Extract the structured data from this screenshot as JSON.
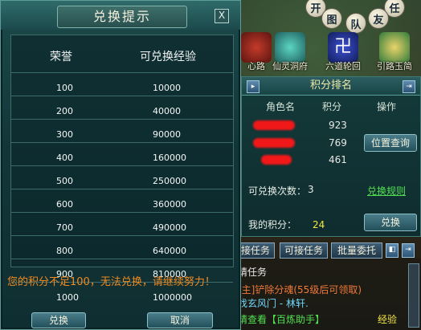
{
  "dialog": {
    "title": "兑换提示",
    "close_label": "X",
    "columns": [
      "荣誉",
      "可兑换经验"
    ],
    "rows": [
      [
        "100",
        "10000"
      ],
      [
        "200",
        "40000"
      ],
      [
        "300",
        "90000"
      ],
      [
        "400",
        "160000"
      ],
      [
        "500",
        "250000"
      ],
      [
        "600",
        "360000"
      ],
      [
        "700",
        "490000"
      ],
      [
        "800",
        "640000"
      ],
      [
        "900",
        "810000"
      ],
      [
        "1000",
        "1000000"
      ]
    ],
    "warning": "您的积分不足100，无法兑换，请继续努力！",
    "confirm_label": "兑换",
    "cancel_label": "取消"
  },
  "top_menu": {
    "round_buttons": [
      "开",
      "任",
      "图",
      "队",
      "友"
    ],
    "features": [
      "心路",
      "仙灵洞府",
      "六道轮回",
      "引路玉简"
    ]
  },
  "ranking": {
    "title": "积分排名",
    "headers": [
      "角色名",
      "积分",
      "操作"
    ],
    "scores": [
      "923",
      "769",
      "461"
    ],
    "query_label": "位置查询",
    "remaining_label": "可兑换次数：",
    "remaining_value": "3",
    "rules_link": "兑换规则",
    "my_score_label": "我的积分：",
    "my_score_value": "24",
    "exchange_label": "兑换"
  },
  "tasks": {
    "tabs": [
      "已接任务",
      "可接任务",
      "批量委托"
    ],
    "lines": [
      "请任务",
      "[主]铲除分魂(55级后可领取)",
      "找玄风门 - 林轩.",
      "请查看【百炼助手】"
    ],
    "footer": "经验"
  },
  "colors": {
    "warning": "#f28a1f",
    "link_green": "#52e052",
    "score_yellow": "#f5e642",
    "title_gold": "#f2e9a8"
  }
}
